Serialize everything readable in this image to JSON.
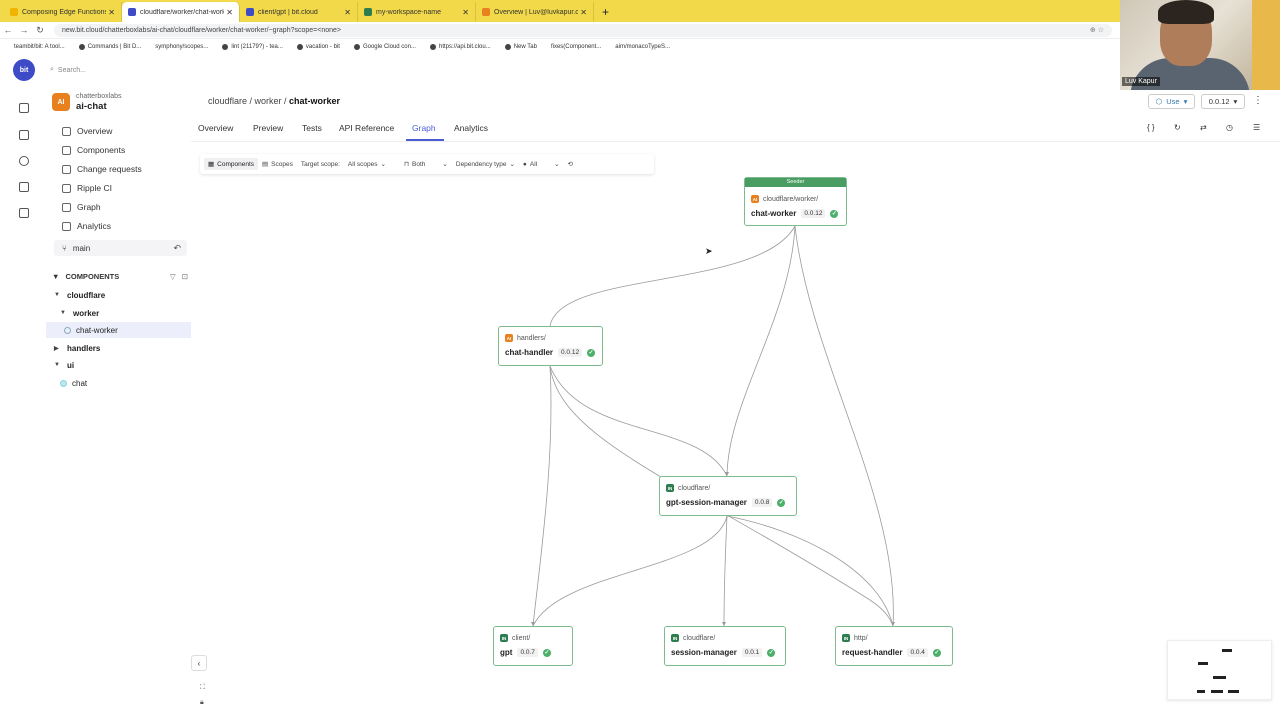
{
  "browser": {
    "tabs": [
      {
        "label": "Composing Edge Functions w",
        "color": "#f1b400"
      },
      {
        "label": "cloudflare/worker/chat-worke",
        "color": "#3d4bc7"
      },
      {
        "label": "client/gpt | bit.cloud",
        "color": "#3d4bc7"
      },
      {
        "label": "my-workspace-name",
        "color": "#2e7d4f"
      },
      {
        "label": "Overview | Luv@luvkapur.com",
        "color": "#e8801e"
      }
    ],
    "new_tab": "+",
    "url": "new.bit.cloud/chatterboxlabs/ai-chat/cloudflare/worker/chat-worker/~graph?scope=<none>",
    "bookmarks": [
      "teambit/bit: A tool...",
      "Commands | Bit D...",
      "symphony/scopes...",
      "lint (21179?) - tea...",
      "vacation - bit",
      "Google Cloud con...",
      "https://api.bit.clou...",
      "New Tab",
      "fixes(Component...",
      "aim/monacoTypeS..."
    ]
  },
  "webcam": {
    "name": "Luv Kapur"
  },
  "search": {
    "placeholder": "Search..."
  },
  "scope": {
    "badge": "AI",
    "owner": "chatterboxlabs",
    "name": "ai-chat"
  },
  "nav": [
    "Overview",
    "Components",
    "Change requests",
    "Ripple CI",
    "Graph",
    "Analytics"
  ],
  "lane": {
    "name": "main"
  },
  "components_header": "COMPONENTS",
  "tree": [
    {
      "label": "cloudflare",
      "level": 0,
      "bold": true,
      "caret": "▼"
    },
    {
      "label": "worker",
      "level": 1,
      "bold": true,
      "caret": "▼"
    },
    {
      "label": "chat-worker",
      "level": 2,
      "bold": false,
      "caret": ""
    },
    {
      "label": "handlers",
      "level": 0,
      "bold": true,
      "caret": "▶"
    },
    {
      "label": "ui",
      "level": 0,
      "bold": true,
      "caret": "▼"
    },
    {
      "label": "chat",
      "level": 1,
      "bold": false,
      "caret": ""
    }
  ],
  "breadcrumb": {
    "prefix": "cloudflare / worker / ",
    "current": "chat-worker"
  },
  "header_actions": {
    "use_label": "Use",
    "version": "0.0.12"
  },
  "tabs": [
    "Overview",
    "Preview",
    "Tests",
    "API Reference",
    "Graph",
    "Analytics"
  ],
  "graph_toolbar": {
    "components": "Components",
    "scopes": "Scopes",
    "target_scope_label": "Target scope:",
    "target_scope_value": "All scopes",
    "direction": "Both",
    "dependency_type": "Dependency type",
    "filter": "All"
  },
  "nodes": {
    "chat_worker": {
      "badge": "Seeder",
      "type": "AI",
      "path": "cloudflare/worker/",
      "name": "chat-worker",
      "version": "0.0.12"
    },
    "chat_handler": {
      "type": "AI",
      "path": "handlers/",
      "name": "chat-handler",
      "version": "0.0.12"
    },
    "gpt_session_manager": {
      "type": "IN",
      "path": "cloudflare/",
      "name": "gpt-session-manager",
      "version": "0.0.8"
    },
    "gpt": {
      "type": "IN",
      "path": "client/",
      "name": "gpt",
      "version": "0.0.7"
    },
    "session_manager": {
      "type": "IN",
      "path": "cloudflare/",
      "name": "session-manager",
      "version": "0.0.1"
    },
    "request_handler": {
      "type": "IN",
      "path": "http/",
      "name": "request-handler",
      "version": "0.0.4"
    }
  },
  "colors": {
    "accent": "#4a5bd4",
    "node_border": "#7dbb8e",
    "seeder": "#4a9d62",
    "ai_icon": "#e8801e",
    "in_icon": "#2e7d4f"
  }
}
